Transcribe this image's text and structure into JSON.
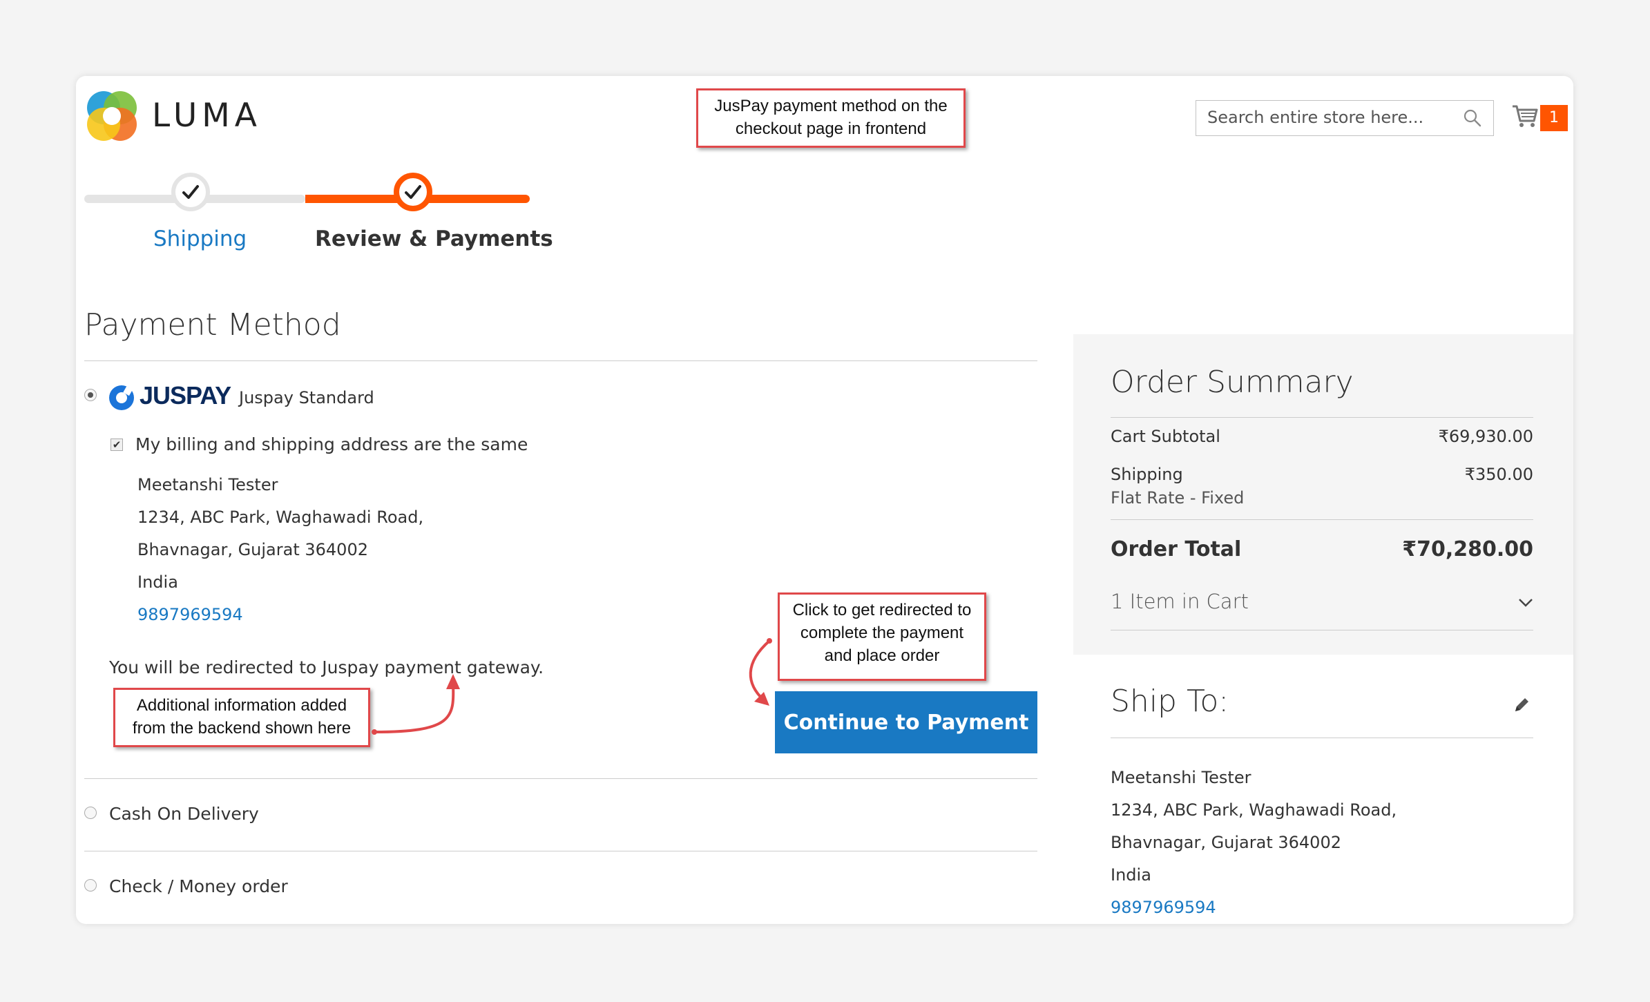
{
  "header": {
    "logo_text": "LUMA",
    "search_placeholder": "Search entire store here...",
    "cart_count": "1"
  },
  "annotations": {
    "top_line1": "JusPay payment method on the",
    "top_line2": "checkout page in frontend",
    "redirect_line1": "Click to get redirected to",
    "redirect_line2": "complete the payment",
    "redirect_line3": "and place order",
    "info_line1": "Additional information added",
    "info_line2": "from the backend shown here"
  },
  "progress": {
    "steps": [
      {
        "label": "Shipping",
        "state": "done"
      },
      {
        "label": "Review & Payments",
        "state": "active"
      }
    ]
  },
  "payment": {
    "title": "Payment Method",
    "juspay_brand": "JUSPAY",
    "juspay_method": "Juspay Standard",
    "billing_same_label": "My billing and shipping address are the same",
    "address": {
      "name": "Meetanshi Tester",
      "street": "1234, ABC Park, Waghawadi Road,",
      "city": "Bhavnagar, Gujarat 364002",
      "country": "India",
      "phone": "9897969594"
    },
    "redirect_note": "You will be redirected to Juspay payment gateway.",
    "continue_label": "Continue to Payment",
    "other_methods": [
      "Cash On Delivery",
      "Check / Money order"
    ]
  },
  "summary": {
    "title": "Order Summary",
    "cart_subtotal_label": "Cart Subtotal",
    "cart_subtotal": "₹69,930.00",
    "shipping_label": "Shipping",
    "shipping_method": "Flat Rate - Fixed",
    "shipping_value": "₹350.00",
    "order_total_label": "Order Total",
    "order_total": "₹70,280.00",
    "items_in_cart": "1 Item in Cart"
  },
  "ship_to": {
    "title": "Ship To:",
    "name": "Meetanshi Tester",
    "street": "1234, ABC Park, Waghawadi Road,",
    "city": "Bhavnagar, Gujarat 364002",
    "country": "India",
    "phone": "9897969594"
  },
  "colors": {
    "accent_orange": "#ff5501",
    "link_blue": "#1979c3",
    "annotation_red": "#e0484a"
  }
}
